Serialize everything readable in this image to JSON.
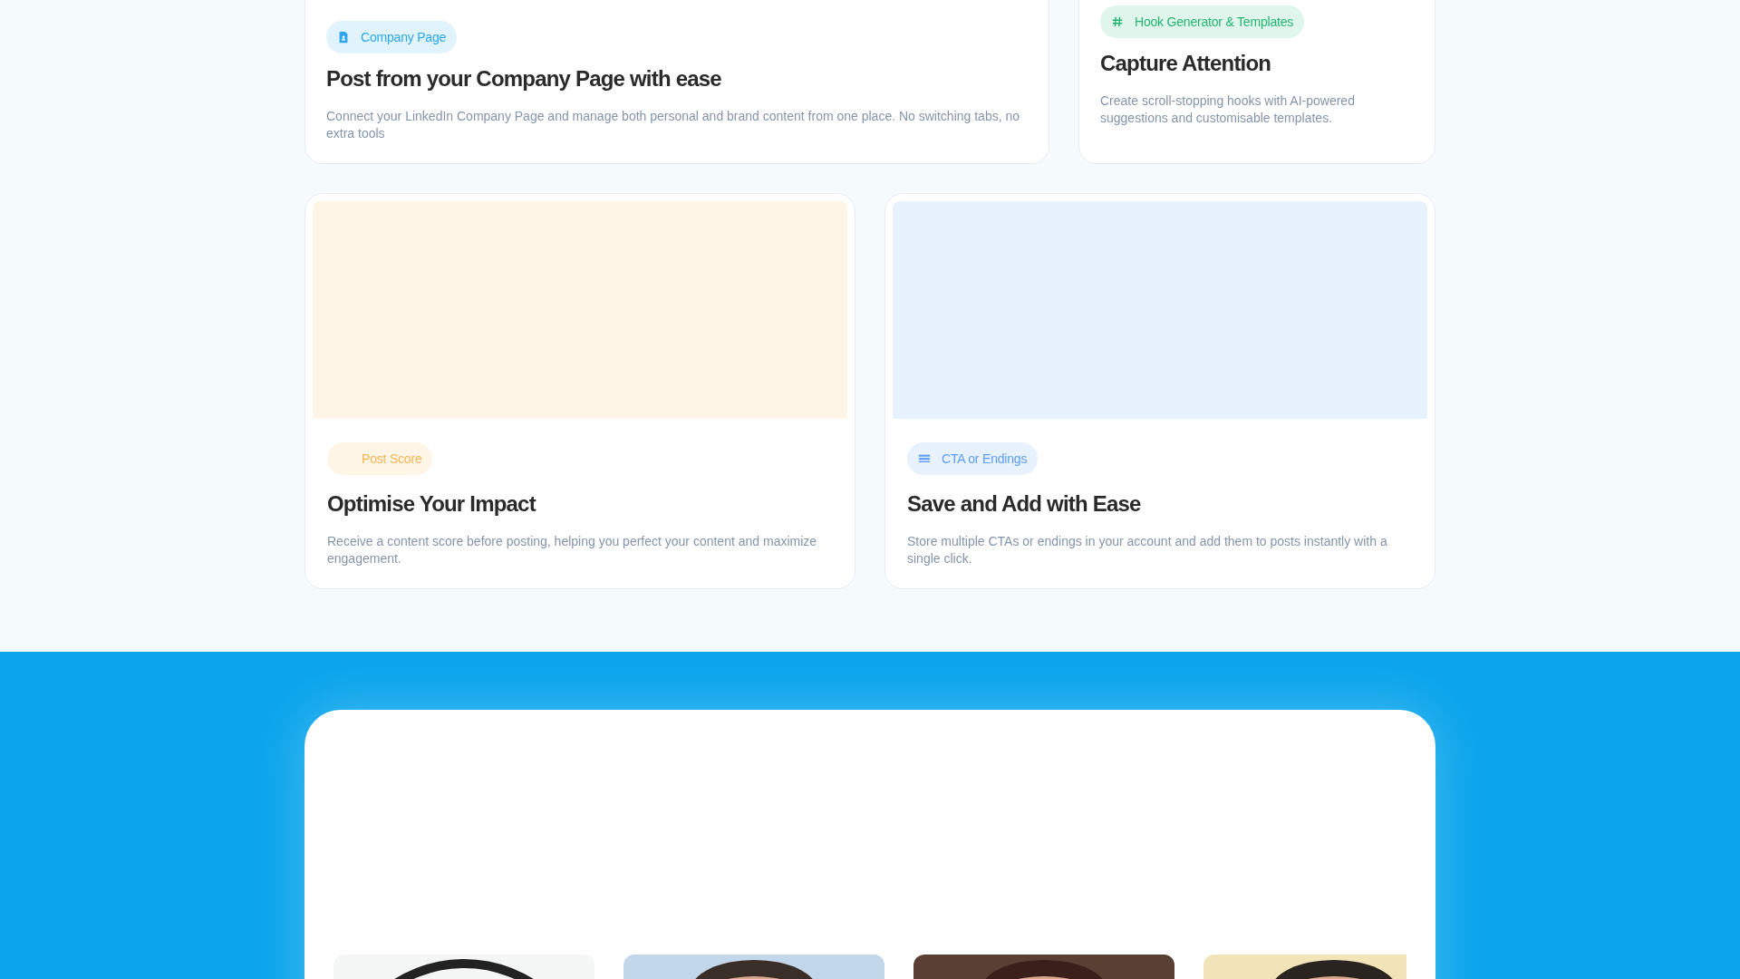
{
  "features_top": [
    {
      "tag": {
        "label": "Company Page",
        "kind": "document",
        "color": "#2aa7f0"
      },
      "title": "Post from your Company Page with ease",
      "description": "Connect your LinkedIn Company Page and manage both personal and brand content from one place. No switching tabs, no extra tools"
    },
    {
      "tag": {
        "label": "Hook Generator & Templates",
        "kind": "hash",
        "color": "#22b573"
      },
      "title": "Capture Attention",
      "description": "Create scroll-stopping hooks with AI-powered suggestions and customisable templates."
    }
  ],
  "features_bottom": [
    {
      "tag": {
        "label": "Post Score",
        "kind": "none",
        "color": "#f7b551"
      },
      "title": "Optimise Your Impact",
      "description": "Receive a content score before posting, helping you perfect your content and maximize engagement."
    },
    {
      "tag": {
        "label": "CTA or Endings",
        "kind": "lines",
        "color": "#5b9ef5"
      },
      "title": "Save and Add with Ease",
      "description": "Store multiple CTAs or endings in your account and add them to posts instantly with a single click."
    }
  ]
}
